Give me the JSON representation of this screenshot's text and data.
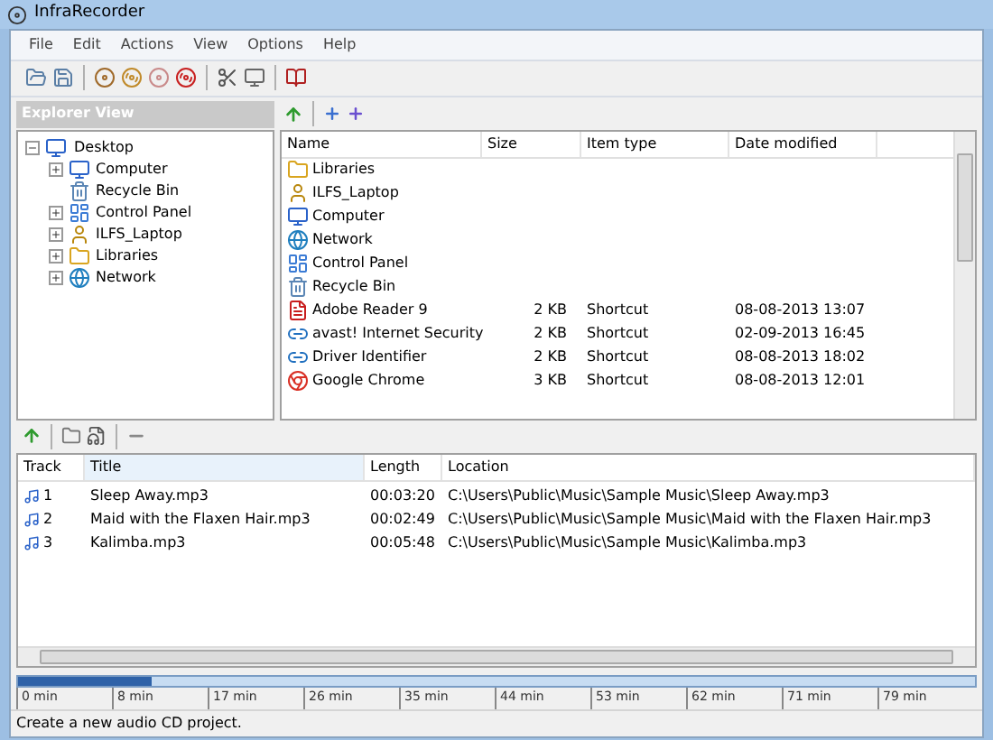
{
  "window": {
    "title": "InfraRecorder"
  },
  "menu": [
    "File",
    "Edit",
    "Actions",
    "View",
    "Options",
    "Help"
  ],
  "explorer": {
    "title": "Explorer View",
    "tree": [
      {
        "label": "Desktop",
        "kind": "desktop",
        "expanded": true,
        "selected": false,
        "children": [
          {
            "label": "Computer",
            "kind": "computer",
            "expanded": false
          },
          {
            "label": "Recycle Bin",
            "kind": "recycle_bin"
          },
          {
            "label": "Control Panel",
            "kind": "control_panel",
            "expanded": false
          },
          {
            "label": "ILFS_Laptop",
            "kind": "user",
            "expanded": false
          },
          {
            "label": "Libraries",
            "kind": "library",
            "expanded": false
          },
          {
            "label": "Network",
            "kind": "network",
            "expanded": false
          }
        ]
      }
    ]
  },
  "files": {
    "columns": [
      "Name",
      "Size",
      "Item type",
      "Date modified"
    ],
    "rows": [
      {
        "kind": "library",
        "name": "Libraries"
      },
      {
        "kind": "user",
        "name": "ILFS_Laptop"
      },
      {
        "kind": "computer",
        "name": "Computer"
      },
      {
        "kind": "network",
        "name": "Network"
      },
      {
        "kind": "control_panel",
        "name": "Control Panel"
      },
      {
        "kind": "recycle_bin",
        "name": "Recycle Bin"
      },
      {
        "kind": "pdf",
        "name": "Adobe Reader 9",
        "size": "2 KB",
        "type": "Shortcut",
        "date": "08-08-2013 13:07"
      },
      {
        "kind": "shortcut",
        "name": "avast! Internet Security",
        "size": "2 KB",
        "type": "Shortcut",
        "date": "02-09-2013 16:45"
      },
      {
        "kind": "shortcut",
        "name": "Driver Identifier",
        "size": "2 KB",
        "type": "Shortcut",
        "date": "08-08-2013 18:02"
      },
      {
        "kind": "browser",
        "name": "Google Chrome",
        "size": "3 KB",
        "type": "Shortcut",
        "date": "08-08-2013 12:01"
      }
    ]
  },
  "tracks": {
    "columns": [
      "Track",
      "Title",
      "Length",
      "Location"
    ],
    "rows": [
      {
        "track": "1",
        "title": "Sleep Away.mp3",
        "length": "00:03:20",
        "location": "C:\\Users\\Public\\Music\\Sample Music\\Sleep Away.mp3"
      },
      {
        "track": "2",
        "title": "Maid with the Flaxen Hair.mp3",
        "length": "00:02:49",
        "location": "C:\\Users\\Public\\Music\\Sample Music\\Maid with the Flaxen Hair.mp3"
      },
      {
        "track": "3",
        "title": "Kalimba.mp3",
        "length": "00:05:48",
        "location": "C:\\Users\\Public\\Music\\Sample Music\\Kalimba.mp3"
      }
    ]
  },
  "disc_usage": {
    "level": 0.14,
    "ticks": [
      "0 min",
      "8 min",
      "17 min",
      "26 min",
      "35 min",
      "44 min",
      "53 min",
      "62 min",
      "71 min",
      "79 min"
    ]
  },
  "status_bar": "Create a new audio CD project."
}
